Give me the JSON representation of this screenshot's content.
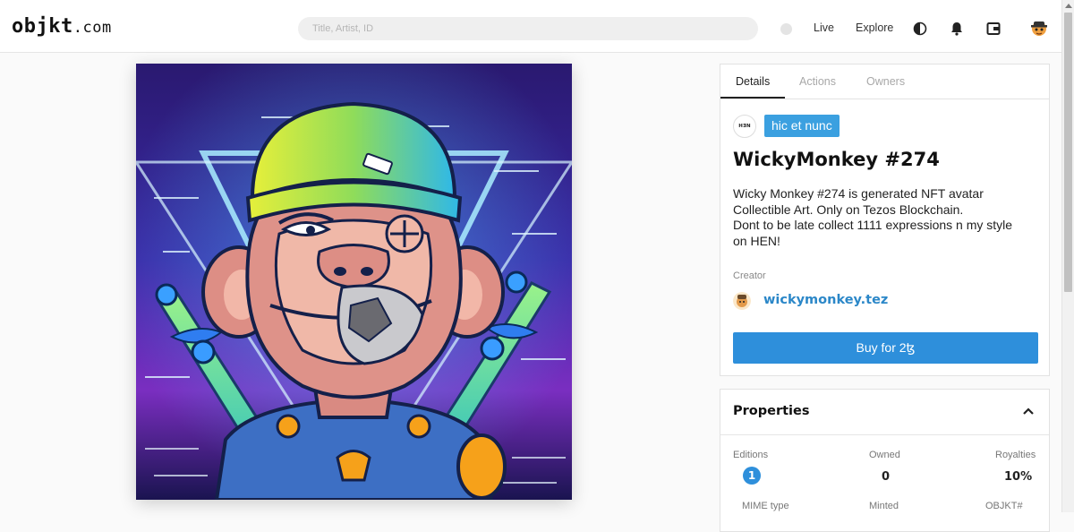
{
  "header": {
    "logo_main": "objkt",
    "logo_suffix": ".com",
    "search_placeholder": "Title, Artist, ID",
    "nav": {
      "live": "Live",
      "explore": "Explore"
    },
    "icons": [
      "theme-toggle-icon",
      "bell-icon",
      "wallet-icon",
      "avatar"
    ]
  },
  "tabs": [
    {
      "label": "Details",
      "active": true
    },
    {
      "label": "Actions",
      "active": false
    },
    {
      "label": "Owners",
      "active": false
    }
  ],
  "token": {
    "platform_logo": "HƎN",
    "platform": "hic et nunc",
    "title": "WickyMonkey #274",
    "description": "Wicky Monkey #274 is generated NFT avatar\nCollectible Art. Only on Tezos Blockchain.\nDont to be late collect 1111 expressions n my style\non HEN!",
    "creator_label": "Creator",
    "creator": "wickymonkey.tez",
    "buy_label": "Buy for 2ꜩ"
  },
  "properties": {
    "title": "Properties",
    "items": [
      {
        "label": "Editions",
        "value": "1"
      },
      {
        "label": "Owned",
        "value": "0"
      },
      {
        "label": "Royalties",
        "value": "10%"
      },
      {
        "label": "MIME type",
        "value": ""
      },
      {
        "label": "Minted",
        "value": ""
      },
      {
        "label": "OBJKT#",
        "value": ""
      }
    ]
  },
  "colors": {
    "accent": "#2e8fdb",
    "badge": "#3ba0e0",
    "creator_link": "#2b87c8"
  }
}
